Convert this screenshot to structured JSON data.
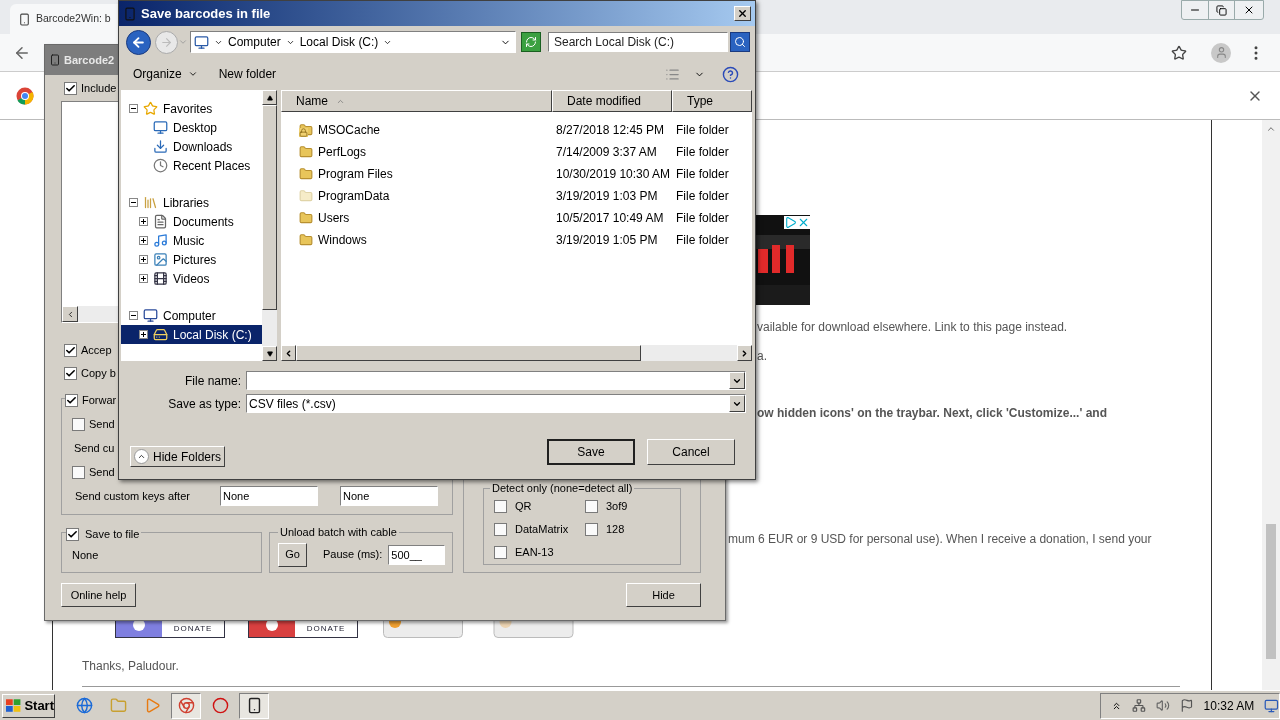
{
  "browser": {
    "tab_title": "Barcode2Win: b",
    "page": {
      "paragraphs": [
        {
          "text": "vailable for download elsewhere. Link to this page instead.",
          "bold": false
        },
        {
          "text": "a.",
          "bold": false
        },
        {
          "text": "ow hidden icons' on the traybar. Next, click 'Customize...' and",
          "bold": true
        },
        {
          "text": "mum 6 EUR or 9 USD for personal use). When I receive a donation, I send your",
          "bold": false
        }
      ],
      "donate_buttons": [
        {
          "kind": "paypal",
          "label": "DONATE",
          "color": "#7f7fe0"
        },
        {
          "kind": "paypal",
          "label": "DONATE",
          "color": "#d84040"
        },
        {
          "kind": "coin"
        },
        {
          "kind": "coin"
        }
      ],
      "closing": "Thanks, Paludour."
    }
  },
  "barcode_window": {
    "title": "Barcode2",
    "options": [
      {
        "label": "Include",
        "checked": true
      },
      {
        "label": "Accep",
        "checked": true
      },
      {
        "label": "Copy b",
        "checked": true
      }
    ],
    "forward": {
      "label": "Forwar",
      "checked": true,
      "items": [
        {
          "kind": "checkbox",
          "label": "Send",
          "checked": false
        },
        {
          "kind": "text",
          "label": "Send cu"
        },
        {
          "kind": "checkbox",
          "label": "Send",
          "checked": false
        },
        {
          "kind": "keys",
          "label": "Send custom keys after",
          "values": [
            "None",
            "None"
          ]
        }
      ]
    },
    "save_to_file": {
      "label": "Save to file",
      "checked": true,
      "path": "None"
    },
    "unload": {
      "title": "Unload batch with cable",
      "go": "Go",
      "pause_label": "Pause (ms):",
      "pause_value": "500__"
    },
    "detect": {
      "title": "Detect only (none=detect all)",
      "types": [
        {
          "label": "QR",
          "checked": false
        },
        {
          "label": "3of9",
          "checked": false
        },
        {
          "label": "DataMatrix",
          "checked": false
        },
        {
          "label": "128",
          "checked": false
        },
        {
          "label": "EAN-13",
          "checked": false
        }
      ]
    },
    "buttons": [
      "Online help",
      "Hide"
    ]
  },
  "dialog": {
    "title": "Save barcodes in file",
    "breadcrumbs": [
      "Computer",
      "Local Disk (C:)"
    ],
    "search_placeholder": "Search Local Disk (C:)",
    "organize": "Organize",
    "new_folder": "New folder",
    "nav": [
      {
        "label": "Favorites",
        "expanded": true,
        "selected": false,
        "children": [
          {
            "label": "Desktop",
            "selected": false
          },
          {
            "label": "Downloads",
            "selected": false
          },
          {
            "label": "Recent Places",
            "selected": false
          }
        ]
      },
      {
        "label": "Libraries",
        "expanded": true,
        "selected": false,
        "children": [
          {
            "label": "Documents",
            "expanded": false,
            "selected": false
          },
          {
            "label": "Music",
            "expanded": false,
            "selected": false
          },
          {
            "label": "Pictures",
            "expanded": false,
            "selected": false
          },
          {
            "label": "Videos",
            "expanded": false,
            "selected": false
          }
        ]
      },
      {
        "label": "Computer",
        "expanded": true,
        "selected": false,
        "children": [
          {
            "label": "Local Disk (C:)",
            "expanded": false,
            "selected": true
          }
        ]
      }
    ],
    "columns": [
      "Name",
      "Date modified",
      "Type"
    ],
    "files": [
      {
        "name": "MSOCache",
        "date": "8/27/2018 12:45 PM",
        "type": "File folder",
        "locked": true,
        "hidden": false,
        "selected": false
      },
      {
        "name": "PerfLogs",
        "date": "7/14/2009 3:37 AM",
        "type": "File folder",
        "locked": false,
        "hidden": false,
        "selected": false
      },
      {
        "name": "Program Files",
        "date": "10/30/2019 10:30 AM",
        "type": "File folder",
        "locked": false,
        "hidden": false,
        "selected": false
      },
      {
        "name": "ProgramData",
        "date": "3/19/2019 1:03 PM",
        "type": "File folder",
        "locked": false,
        "hidden": true,
        "selected": false
      },
      {
        "name": "Users",
        "date": "10/5/2017 10:49 AM",
        "type": "File folder",
        "locked": false,
        "hidden": false,
        "selected": false
      },
      {
        "name": "Windows",
        "date": "3/19/2019 1:05 PM",
        "type": "File folder",
        "locked": false,
        "hidden": false,
        "selected": false
      }
    ],
    "file_name_label": "File name:",
    "save_type_label": "Save as type:",
    "save_type": "CSV files (*.csv)",
    "hide_folders": "Hide Folders",
    "buttons": [
      "Save",
      "Cancel"
    ]
  },
  "taskbar": {
    "start": "Start",
    "apps": [
      {
        "active": false
      },
      {
        "active": false
      },
      {
        "active": false
      },
      {
        "active": true
      },
      {
        "active": false
      },
      {
        "active": true
      }
    ],
    "clock": "10:32 AM"
  }
}
